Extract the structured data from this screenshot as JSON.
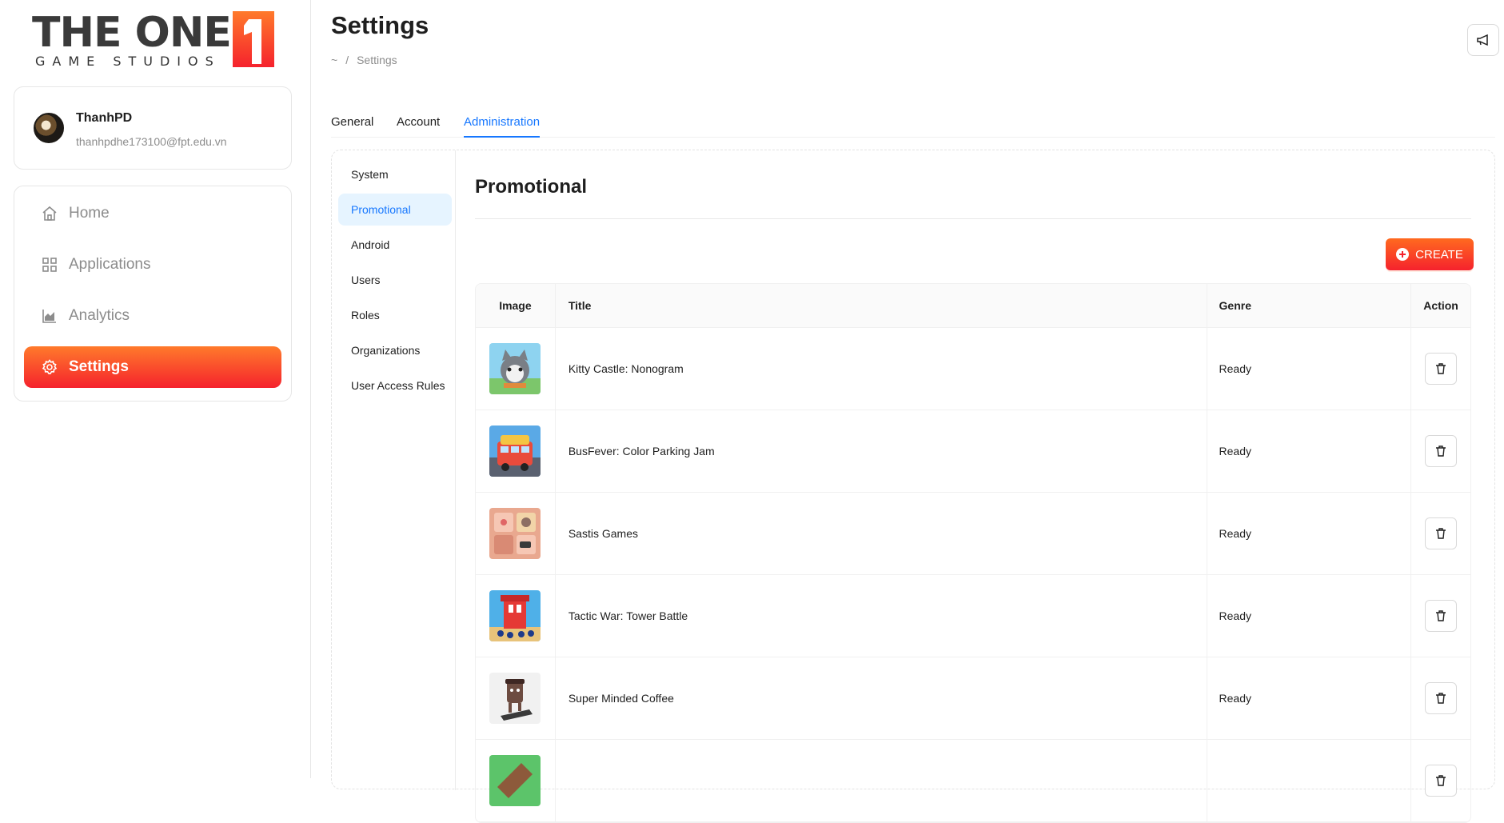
{
  "brand": {
    "logo_text": "THE ONE",
    "logo_sub": "GAME STUDIOS",
    "logo_mark": "1"
  },
  "profile": {
    "name": "ThanhPD",
    "email": "thanhpdhe173100@fpt.edu.vn"
  },
  "nav": {
    "items": [
      {
        "label": "Home",
        "icon": "home-icon",
        "active": false
      },
      {
        "label": "Applications",
        "icon": "grid-icon",
        "active": false
      },
      {
        "label": "Analytics",
        "icon": "chart-icon",
        "active": false
      },
      {
        "label": "Settings",
        "icon": "gear-icon",
        "active": true
      }
    ]
  },
  "header": {
    "title": "Settings",
    "breadcrumb_home": "~",
    "breadcrumb_sep": "/",
    "breadcrumb_current": "Settings"
  },
  "tabs": [
    {
      "label": "General",
      "active": false
    },
    {
      "label": "Account",
      "active": false
    },
    {
      "label": "Administration",
      "active": true
    }
  ],
  "sub_menu": [
    {
      "label": "System",
      "active": false
    },
    {
      "label": "Promotional",
      "active": true
    },
    {
      "label": "Android",
      "active": false
    },
    {
      "label": "Users",
      "active": false
    },
    {
      "label": "Roles",
      "active": false
    },
    {
      "label": "Organizations",
      "active": false
    },
    {
      "label": "User Access Rules",
      "active": false
    }
  ],
  "section": {
    "title": "Promotional",
    "create_label": "CREATE"
  },
  "table": {
    "headers": {
      "image": "Image",
      "title": "Title",
      "genre": "Genre",
      "action": "Action"
    },
    "rows": [
      {
        "title": "Kitty Castle: Nonogram",
        "genre": "Ready"
      },
      {
        "title": "BusFever: Color Parking Jam",
        "genre": "Ready"
      },
      {
        "title": "Sastis Games",
        "genre": "Ready"
      },
      {
        "title": "Tactic War: Tower Battle",
        "genre": "Ready"
      },
      {
        "title": "Super Minded Coffee",
        "genre": "Ready"
      }
    ]
  },
  "colors": {
    "accent_gradient_start": "#ff7a2b",
    "accent_gradient_end": "#f5222d",
    "link_blue": "#1677ff",
    "selected_bg": "#e6f4ff"
  }
}
